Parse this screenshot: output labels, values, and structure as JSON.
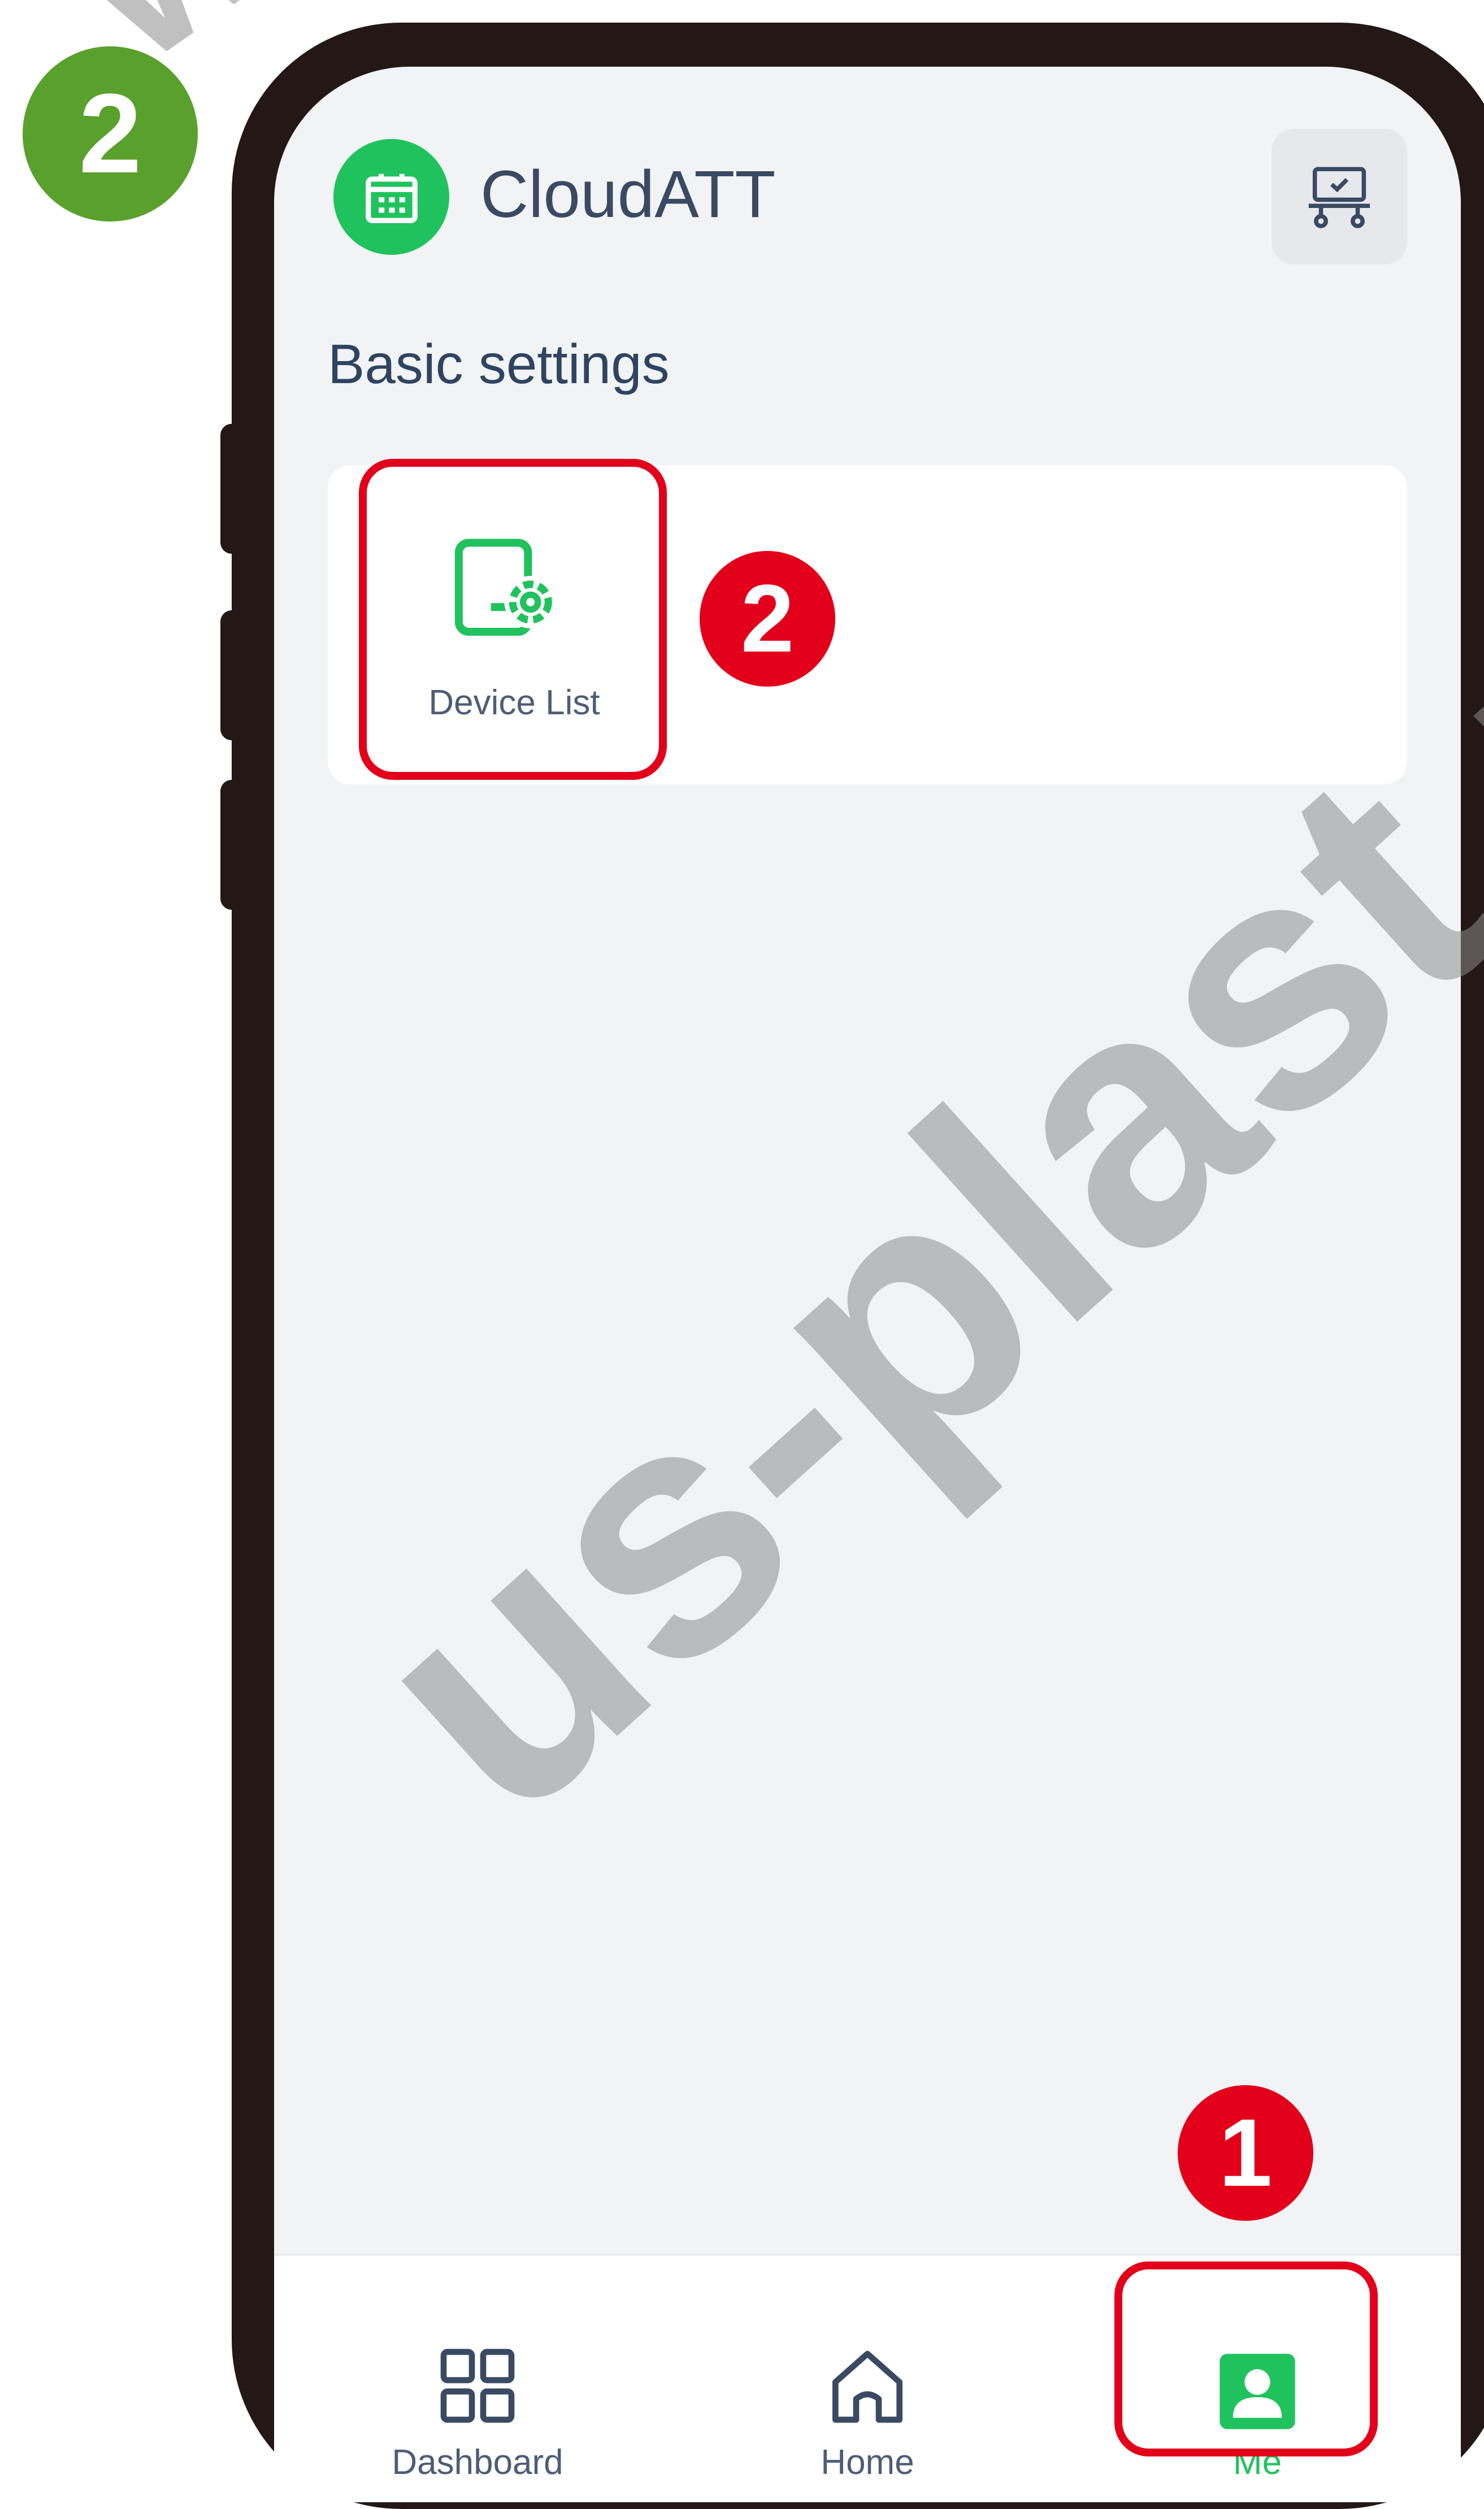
{
  "step_badge": "2",
  "header": {
    "app_title": "CloudATT",
    "logo_icon": "calendar-icon",
    "action_icon": "device-monitor-icon"
  },
  "section": {
    "title": "Basic settings",
    "items": [
      {
        "label": "Device List",
        "icon": "device-settings-icon"
      }
    ]
  },
  "callouts": {
    "device_list": "2",
    "me_tab": "1"
  },
  "bottom_nav": {
    "items": [
      {
        "label": "Dashboard",
        "icon": "grid-icon",
        "active": false
      },
      {
        "label": "Home",
        "icon": "home-icon",
        "active": false
      },
      {
        "label": "Me",
        "icon": "person-icon",
        "active": true
      }
    ]
  },
  "watermark": {
    "main": "us-plast.ru",
    "top": "ww"
  },
  "colors": {
    "accent": "#20c25d",
    "highlight": "#e2001a",
    "text": "#3b4a63",
    "background": "#f2f3f5",
    "frame": "#231815",
    "step_badge": "#5aa02c"
  }
}
